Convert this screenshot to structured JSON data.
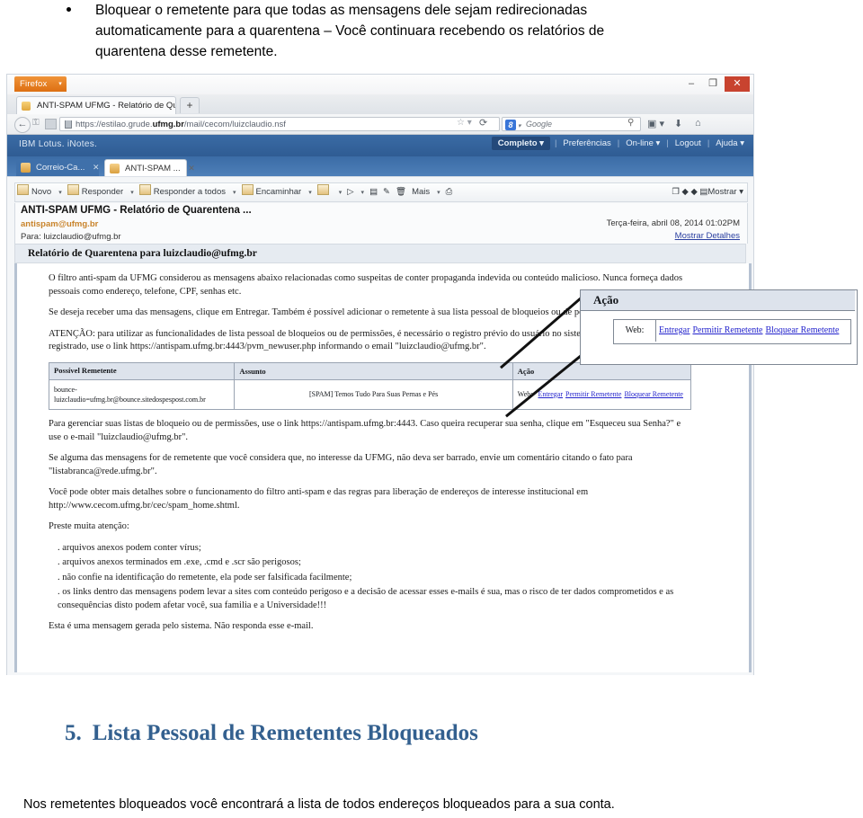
{
  "document": {
    "bullet": {
      "line1": "Bloquear o remetente para que todas as mensagens dele sejam redirecionadas",
      "line2": "automaticamente para a quarentena – Você continuara recebendo os relatórios de",
      "line3": "quarentena desse remetente."
    },
    "section": {
      "number": "5.",
      "title": "Lista Pessoal de Remetentes Bloqueados"
    },
    "closing_text": "Nos remetentes bloqueados você encontrará a lista de todos endereços bloqueados para a sua conta."
  },
  "browser": {
    "app_button": "Firefox",
    "app_button_caret": "▾",
    "window_controls": {
      "minimize": "–",
      "maximize": "❐",
      "close": "✕"
    },
    "tab": {
      "title": "ANTI-SPAM UFMG - Relatório de Quare...",
      "new_tab": "+"
    },
    "url": {
      "prefix": "https://estilao.grude.",
      "domain": "ufmg.br",
      "suffix": "/mail/cecom/luizclaudio.nsf"
    },
    "url_star": "☆ ▾",
    "url_reload": "⟳",
    "search": {
      "engine_letter": "8",
      "engine_caret": "▾",
      "placeholder": "Google",
      "magnifier": "⚲"
    },
    "toolbar_icons": {
      "downloads_box": "▣ ▾",
      "download_arrow": "⬇",
      "home": "⌂"
    }
  },
  "inotes": {
    "logo": "IBM Lotus. iNotes.",
    "menu": {
      "completo": "Completo ▾",
      "preferencias": "Preferências",
      "online": "On-line ▾",
      "logout": "Logout",
      "ajuda": "Ajuda ▾",
      "separator": "|"
    },
    "tabs": [
      {
        "label": "Correio-Ca...",
        "close": "✕"
      },
      {
        "label": "ANTI-SPAM ...",
        "close": "✕"
      }
    ]
  },
  "mail": {
    "toolbar": {
      "items": [
        "Novo",
        "Responder",
        "Responder a todos",
        "Encaminhar"
      ],
      "more": "Mais",
      "caret": "▾",
      "right_label": "Mostrar",
      "right_caret": "▾"
    },
    "message": {
      "subject": "ANTI-SPAM UFMG - Relatório de Quarentena ...",
      "from": "antispam@ufmg.br",
      "to_label": "Para:",
      "to": "luizclaudio@ufmg.br",
      "date": "Terça-feira, abril 08, 2014 01:02PM",
      "details_link": "Mostrar Detalhes",
      "banner": "Relatório de Quarentena para luizclaudio@ufmg.br"
    },
    "body": {
      "p1": "O filtro anti-spam da UFMG considerou as mensagens abaixo relacionadas como suspeitas de conter propaganda indevida ou conteúdo malicioso. Nunca forneça dados pessoais como endereço, telefone, CPF, senhas etc.",
      "p2": "Se deseja receber uma das mensagens, clique em Entregar. Também é possível adicionar o remetente à sua lista pessoal de bloqueios ou de permissões.",
      "p3": "ATENÇÃO: para utilizar as funcionalidades de lista pessoal de bloqueios ou de permissões, é necessário o registro prévio do usuário no sistema. Caso ainda não esteja registrado, use o link https://antispam.ufmg.br:4443/pvm_newuser.php informando o email \"luizclaudio@ufmg.br\".",
      "p4": "Para gerenciar suas listas de bloqueio ou de permissões, use o link https://antispam.ufmg.br:4443. Caso queira recuperar sua senha, clique em \"Esqueceu sua Senha?\" e use o e-mail \"luizclaudio@ufmg.br\".",
      "p5": "Se alguma das mensagens for de remetente que você considera que, no interesse da UFMG, não deva ser barrado, envie um comentário citando o fato para \"listabranca@rede.ufmg.br\".",
      "p6": "Você pode obter mais detalhes sobre o funcionamento do filtro anti-spam e das regras para liberação de endereços de interesse institucional em http://www.cecom.ufmg.br/cec/spam_home.shtml.",
      "attention_heading": "Preste muita atenção:",
      "attention_items": [
        ". arquivos anexos podem conter vírus;",
        ". arquivos anexos terminados em .exe, .cmd e .scr são perigosos;",
        ". não confie na identificação do remetente, ela pode ser falsificada facilmente;",
        ". os links dentro das mensagens podem levar a sites com conteúdo perigoso e a decisão de acessar esses e-mails é sua, mas o risco de ter dados comprometidos e as consequências disto podem afetar você, sua familia e a Universidade!!!"
      ],
      "footer": "Esta é uma mensagem gerada pelo sistema. Não responda esse e-mail."
    },
    "spam_table": {
      "headers": [
        "Possível Remetente",
        "Assunto",
        "Ação"
      ],
      "rows": [
        {
          "sender_line1": "bounce-",
          "sender_line2": "luizclaudio=ufmg.br@bounce.sitedospespost.com.br",
          "subject": "[SPAM] Temos Tudo Para Suas Pernas e Pés",
          "action_web_label": "Web:",
          "action_links": [
            "Entregar",
            "Permitir Remetente",
            "Bloquear Remetente"
          ]
        }
      ]
    }
  },
  "callout": {
    "title": "Ação",
    "web_label": "Web:",
    "links": [
      "Entregar",
      "Permitir Remetente",
      "Bloquear Remetente"
    ]
  },
  "colors": {
    "accent_blue": "#33608f",
    "inotes_header": "#2f5c93",
    "link_blue": "#2222cc",
    "from_orange": "#c8832a",
    "close_red": "#c8432f"
  }
}
